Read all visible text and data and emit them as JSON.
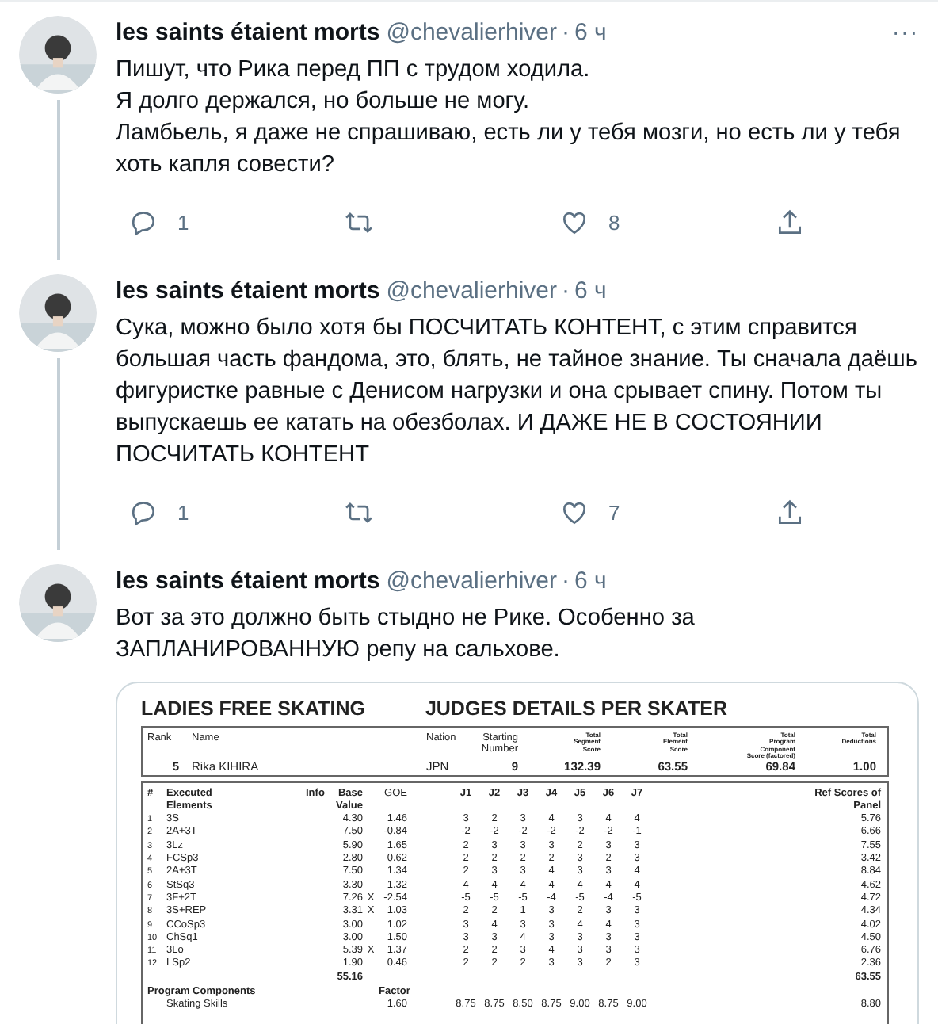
{
  "tweets": [
    {
      "author": "les saints étaient morts",
      "handle": "@chevalierhiver",
      "separator": "·",
      "time": "6 ч",
      "more": "···",
      "connected": true,
      "text": "Пишут, что Рика перед ПП с трудом ходила.\nЯ долго держался, но больше не могу.\nЛамбьель, я даже не спрашиваю, есть ли у тебя мозги, но есть ли у тебя\nхоть капля совести?",
      "actions": {
        "replies": "1",
        "likes": "8"
      }
    },
    {
      "author": "les saints étaient morts",
      "handle": "@chevalierhiver",
      "separator": "·",
      "time": "6 ч",
      "connected": true,
      "text": "Сука, можно было хотя бы ПОСЧИТАТЬ КОНТЕНТ, с этим справится\nбольшая часть фандома, это, блять, не тайное знание. Ты сначала даёшь\nфигуристке равные с Денисом нагрузки и она срывает спину. Потом ты\nвыпускаешь ее катать на обезболах. И ДАЖЕ НЕ В СОСТОЯНИИ\nПОСЧИТАТЬ КОНТЕНТ",
      "actions": {
        "replies": "1",
        "likes": "7"
      }
    },
    {
      "author": "les saints étaient morts",
      "handle": "@chevalierhiver",
      "separator": "·",
      "time": "6 ч",
      "text": "Вот за это должно быть стыдно не Рике. Особенно за\nЗАПЛАНИРОВАННУЮ репу на сальхове.",
      "document": {
        "title_left": "LADIES FREE SKATING",
        "title_right": "JUDGES DETAILS PER SKATER",
        "summary": {
          "columns": [
            "Rank",
            "Name",
            "Nation",
            "Starting\nNumber",
            "Total\nSegment\nScore",
            "Total\nElement\nScore",
            "Total\nProgram\nComponent\nScore (factored)",
            "Total\nDeductions"
          ],
          "values": [
            "5",
            "Rika KIHIRA",
            "JPN",
            "9",
            "132.39",
            "63.55",
            "69.84",
            "1.00"
          ]
        },
        "element_headers": {
          "num": "#",
          "element": "Executed\nElements",
          "info": "Info",
          "base": "Base\nValue",
          "goe": "GOE",
          "judges": [
            "J1",
            "J2",
            "J3",
            "J4",
            "J5",
            "J6",
            "J7"
          ],
          "ref": "Ref Scores of\nPanel"
        },
        "elements": [
          {
            "num": "1",
            "element": "3S",
            "base": "4.30",
            "goe": "1.46",
            "judges": [
              "3",
              "2",
              "3",
              "4",
              "3",
              "4",
              "4"
            ],
            "ref": "5.76"
          },
          {
            "num": "2",
            "element": "2A+3T",
            "base": "7.50",
            "goe": "-0.84",
            "judges": [
              "-2",
              "-2",
              "-2",
              "-2",
              "-2",
              "-2",
              "-1"
            ],
            "ref": "6.66"
          },
          {
            "num": "3",
            "element": "3Lz",
            "base": "5.90",
            "goe": "1.65",
            "judges": [
              "2",
              "3",
              "3",
              "3",
              "2",
              "3",
              "3"
            ],
            "ref": "7.55"
          },
          {
            "num": "4",
            "element": "FCSp3",
            "base": "2.80",
            "goe": "0.62",
            "judges": [
              "2",
              "2",
              "2",
              "2",
              "3",
              "2",
              "3"
            ],
            "ref": "3.42"
          },
          {
            "num": "5",
            "element": "2A+3T",
            "base": "7.50",
            "goe": "1.34",
            "judges": [
              "2",
              "3",
              "3",
              "4",
              "3",
              "3",
              "4"
            ],
            "ref": "8.84"
          },
          {
            "num": "6",
            "element": "StSq3",
            "base": "3.30",
            "goe": "1.32",
            "judges": [
              "4",
              "4",
              "4",
              "4",
              "4",
              "4",
              "4"
            ],
            "ref": "4.62"
          },
          {
            "num": "7",
            "element": "3F+2T",
            "base": "7.26",
            "info": "X",
            "goe": "-2.54",
            "judges": [
              "-5",
              "-5",
              "-5",
              "-4",
              "-5",
              "-4",
              "-5"
            ],
            "ref": "4.72"
          },
          {
            "num": "8",
            "element": "3S+REP",
            "base": "3.31",
            "info": "X",
            "goe": "1.03",
            "judges": [
              "2",
              "2",
              "1",
              "3",
              "2",
              "3",
              "3"
            ],
            "ref": "4.34"
          },
          {
            "num": "9",
            "element": "CCoSp3",
            "base": "3.00",
            "goe": "1.02",
            "judges": [
              "3",
              "4",
              "3",
              "3",
              "4",
              "4",
              "3"
            ],
            "ref": "4.02"
          },
          {
            "num": "10",
            "element": "ChSq1",
            "base": "3.00",
            "goe": "1.50",
            "judges": [
              "3",
              "3",
              "4",
              "3",
              "3",
              "3",
              "3"
            ],
            "ref": "4.50"
          },
          {
            "num": "11",
            "element": "3Lo",
            "base": "5.39",
            "info": "X",
            "goe": "1.37",
            "judges": [
              "2",
              "2",
              "3",
              "4",
              "3",
              "3",
              "3"
            ],
            "ref": "6.76"
          },
          {
            "num": "12",
            "element": "LSp2",
            "base": "1.90",
            "goe": "0.46",
            "judges": [
              "2",
              "2",
              "2",
              "3",
              "3",
              "2",
              "3"
            ],
            "ref": "2.36"
          }
        ],
        "total_base": "55.16",
        "total_ref": "63.55",
        "components_header": "Program Components",
        "factor_header": "Factor",
        "components": [
          {
            "name": "Skating Skills",
            "factor": "1.60",
            "judges": [
              "8.75",
              "8.75",
              "8.50",
              "8.75",
              "9.00",
              "8.75",
              "9.00"
            ],
            "ref": "8.80"
          }
        ]
      }
    }
  ]
}
